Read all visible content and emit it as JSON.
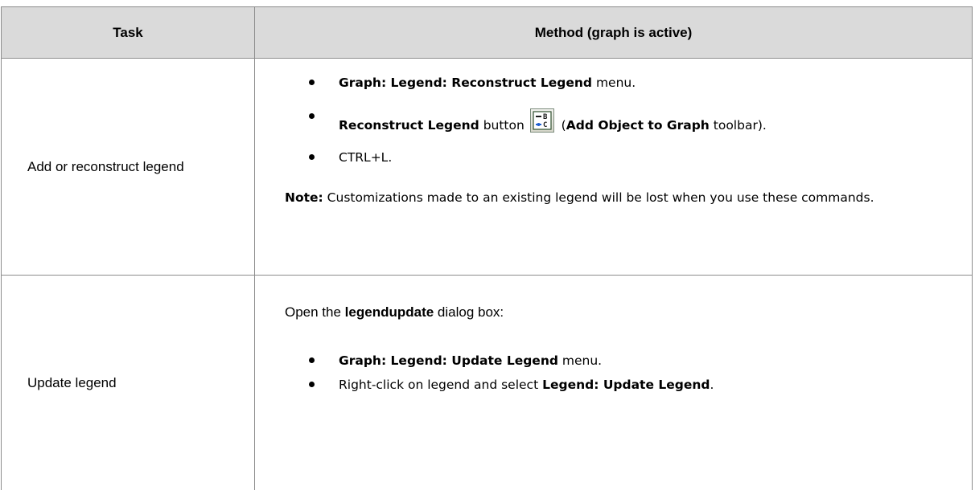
{
  "table": {
    "headers": {
      "task": "Task",
      "method": "Method (graph is active)"
    },
    "rows": [
      {
        "task": "Add or reconstruct legend",
        "bullets": [
          {
            "bold": "Graph: Legend: Reconstruct Legend",
            "after": " menu."
          },
          {
            "bold": "Reconstruct Legend",
            "middle": " button ",
            "icon": "reconstruct-legend-icon",
            "open_paren": " (",
            "bold2": "Add Object to Graph",
            "after": " toolbar)."
          },
          {
            "plain": "CTRL+L."
          }
        ],
        "note": {
          "label": "Note:",
          "text": " Customizations made to an existing legend will be lost when you use these commands."
        }
      },
      {
        "task": "Update legend",
        "intro": {
          "before": "Open the ",
          "bold": "legendupdate",
          "after": " dialog box:"
        },
        "bullets": [
          {
            "bold": "Graph: Legend: Update Legend",
            "after": " menu."
          },
          {
            "before": "Right-click on legend and select ",
            "bold": "Legend: Update Legend",
            "after": "."
          }
        ]
      }
    ]
  },
  "colors": {
    "header_bg": "#dadada",
    "border": "#8c8c8c",
    "text": "#000000"
  }
}
